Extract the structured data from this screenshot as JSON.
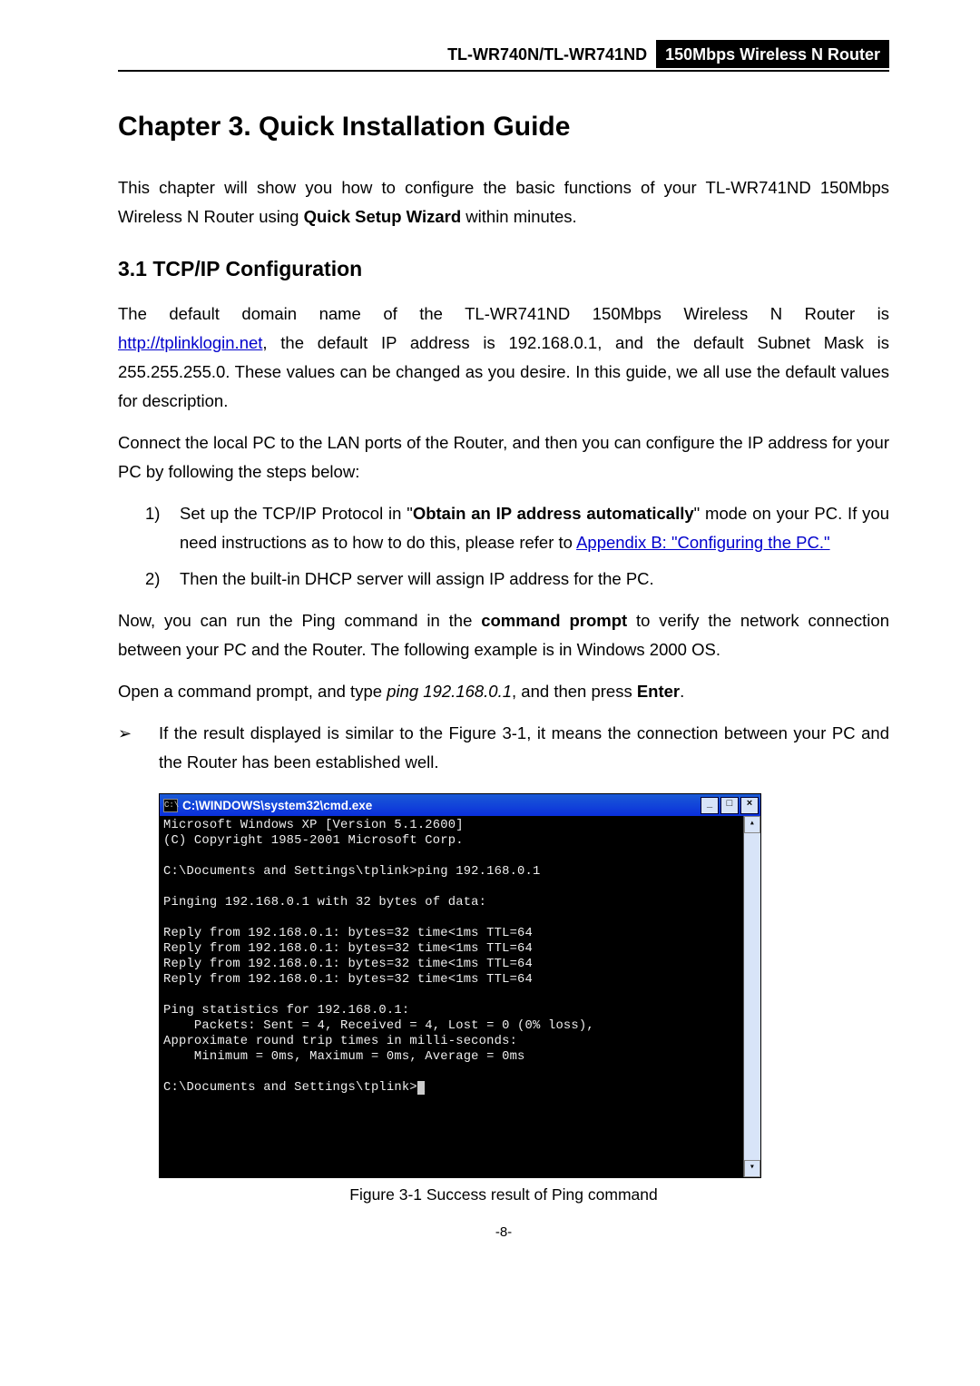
{
  "header": {
    "model": "TL-WR740N/TL-WR741ND",
    "product": "150Mbps Wireless N Router"
  },
  "chapter_title": "Chapter 3.  Quick Installation Guide",
  "intro_1a": "This chapter will show you how to configure the basic functions of your TL-WR741ND 150Mbps Wireless N Router using ",
  "intro_1b": "Quick Setup Wizard",
  "intro_1c": " within minutes.",
  "section_3_1": "3.1   TCP/IP Configuration",
  "p_default_a": "The default domain name of the TL-WR741ND 150Mbps Wireless N Router is ",
  "p_default_link": "http://tplinklogin.net",
  "p_default_b": ", the default IP address is 192.168.0.1, and the default Subnet Mask is 255.255.255.0. These values can be changed as you desire. In this guide, we all use the default values for description.",
  "p_connect": "Connect the local PC to the LAN ports of the Router, and then you can configure the IP address for your PC by following the steps below:",
  "step1_a": "Set up the TCP/IP Protocol in \"",
  "step1_b": "Obtain an IP address automatically",
  "step1_c": "\" mode on your PC. If you need instructions as to how to do this, please refer to ",
  "step1_link": "Appendix B: \"Configuring the PC.\"",
  "step2": "Then the built-in DHCP server will assign IP address for the PC.",
  "p_now_a": "Now, you can run the Ping command in the ",
  "p_now_b": "command prompt",
  "p_now_c": " to verify the network connection between your PC and the Router. The following example is in Windows 2000 OS.",
  "p_open_a": "Open a command prompt, and type ",
  "p_open_b": "ping 192.168.0.1",
  "p_open_c": ", and then press ",
  "p_open_d": "Enter",
  "p_open_e": ".",
  "bullet_a": "If the result displayed is similar to the ",
  "bullet_b": "Figure 3-1",
  "bullet_c": ", it means the connection between your PC and the Router has been established well.",
  "cmd": {
    "title": "C:\\WINDOWS\\system32\\cmd.exe",
    "icon_text": "C:\\",
    "lines": "Microsoft Windows XP [Version 5.1.2600]\n(C) Copyright 1985-2001 Microsoft Corp.\n\nC:\\Documents and Settings\\tplink>ping 192.168.0.1\n\nPinging 192.168.0.1 with 32 bytes of data:\n\nReply from 192.168.0.1: bytes=32 time<1ms TTL=64\nReply from 192.168.0.1: bytes=32 time<1ms TTL=64\nReply from 192.168.0.1: bytes=32 time<1ms TTL=64\nReply from 192.168.0.1: bytes=32 time<1ms TTL=64\n\nPing statistics for 192.168.0.1:\n    Packets: Sent = 4, Received = 4, Lost = 0 (0% loss),\nApproximate round trip times in milli-seconds:\n    Minimum = 0ms, Maximum = 0ms, Average = 0ms\n\nC:\\Documents and Settings\\tplink>"
  },
  "figure_caption": "Figure 3-1   Success result of Ping command",
  "page_number": "-8-"
}
